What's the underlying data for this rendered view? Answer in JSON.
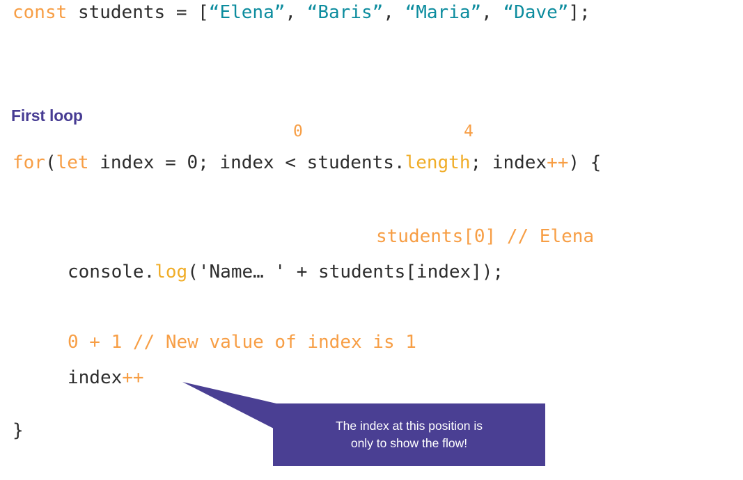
{
  "meta": {
    "background_color": "#ffffff",
    "accent_purple": "#4a3f93",
    "accent_orange": "#f79e45",
    "accent_yellow": "#f0ad28",
    "accent_teal": "#0c8c9e",
    "code_text_color": "#2d2d2d"
  },
  "heading": {
    "label": "First loop"
  },
  "code": {
    "line_declaration": {
      "keyword": "const",
      "space1": " ",
      "identifier": "students",
      "assign": " = [",
      "str1": "“Elena”",
      "sep1": ", ",
      "str2": "“Baris”",
      "sep2": ", ",
      "str3": "“Maria”",
      "sep3": ", ",
      "str4": "“Dave”",
      "tail": "];"
    },
    "line_for": {
      "kw_for": "for",
      "paren": "(",
      "kw_let": "let",
      "init": " index = 0; index ",
      "lt": "<",
      "mid": " students.",
      "prop_length": "length",
      "after": "; index",
      "plusplus": "++",
      "close": ") {"
    },
    "line_console": {
      "prefix": "console.",
      "prop_log": "log",
      "rest": "('Name… ' + students[index]);"
    },
    "line_index": {
      "identifier": "index",
      "plusplus": "++"
    },
    "line_closing_brace": "}"
  },
  "annotations": {
    "index_start": "0",
    "array_length": "4",
    "array_access_comment": "students[0] // Elena",
    "increment_comment": "0 + 1 // New value of index is 1"
  },
  "callout": {
    "text": "The index at this position is\nonly to show the flow!",
    "background_color": "#4a3f93",
    "text_color": "#ffffff"
  }
}
